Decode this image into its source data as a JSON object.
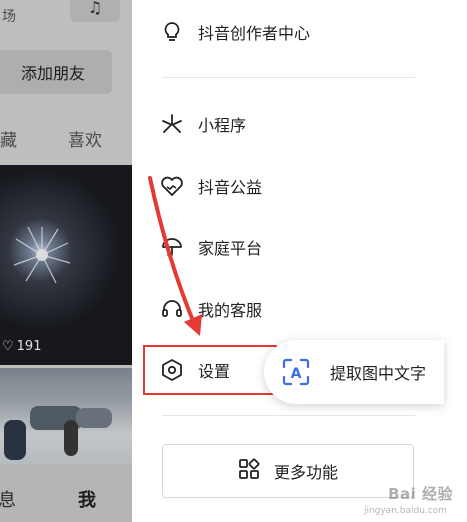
{
  "left_pane": {
    "top_text": "场",
    "music_icon": "music-note-icon",
    "add_friend_label": "添加朋友",
    "tabs": [
      "藏",
      "喜欢"
    ],
    "likes_count": "191",
    "bottom_nav": [
      "息",
      "我"
    ]
  },
  "drawer": {
    "menu": [
      {
        "label": "抖音创作者中心",
        "icon": "lightbulb-icon"
      },
      {
        "label": "小程序",
        "icon": "mini-program-icon"
      },
      {
        "label": "抖音公益",
        "icon": "charity-heart-icon"
      },
      {
        "label": "家庭平台",
        "icon": "umbrella-icon"
      },
      {
        "label": "我的客服",
        "icon": "headset-icon"
      },
      {
        "label": "设置",
        "icon": "hexagon-settings-icon"
      }
    ],
    "more_label": "更多功能",
    "more_icon": "grid-apps-icon"
  },
  "ocr": {
    "label": "提取图中文字",
    "icon": "text-scan-icon"
  },
  "annotation": {
    "color": "#e53935"
  },
  "watermark": {
    "text": "Bai 经验",
    "sub": "jingyan.baidu.com"
  }
}
